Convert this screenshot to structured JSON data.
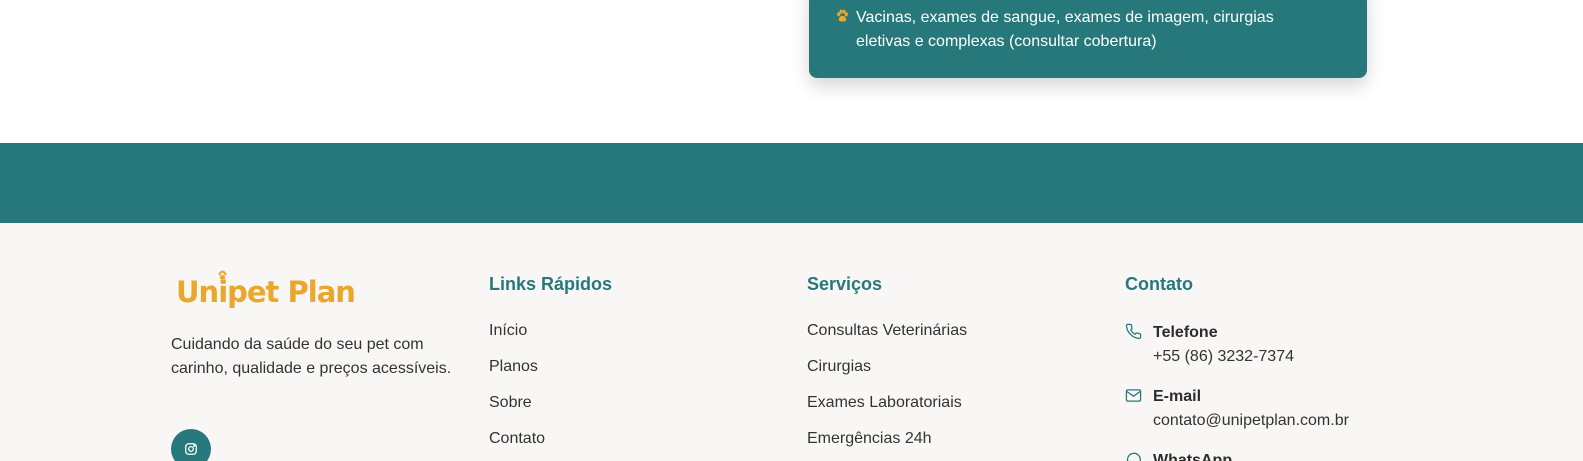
{
  "feature_card": {
    "item_text": "Vacinas, exames de sangue, exames de imagem, cirurgias eletivas e complexas (consultar cobertura)",
    "icon": "paw-icon"
  },
  "colors": {
    "teal": "#27787a",
    "gold": "#e9a72b",
    "footer_bg": "#f8f7f5"
  },
  "footer": {
    "brand": {
      "logo_text": "Unipet Plan",
      "tagline": "Cuidando da saúde do seu pet com carinho, qualidade e preços acessíveis.",
      "social_icon": "instagram-icon"
    },
    "quick_links": {
      "title": "Links Rápidos",
      "items": [
        "Início",
        "Planos",
        "Sobre",
        "Contato"
      ]
    },
    "services": {
      "title": "Serviços",
      "items": [
        "Consultas Veterinárias",
        "Cirurgias",
        "Exames Laboratoriais",
        "Emergências 24h"
      ]
    },
    "contact": {
      "title": "Contato",
      "items": [
        {
          "icon": "phone-icon",
          "label": "Telefone",
          "value": "+55 (86) 3232-7374"
        },
        {
          "icon": "mail-icon",
          "label": "E-mail",
          "value": "contato@unipetplan.com.br"
        },
        {
          "icon": "whatsapp-icon",
          "label": "WhatsApp",
          "value": ""
        }
      ]
    }
  }
}
